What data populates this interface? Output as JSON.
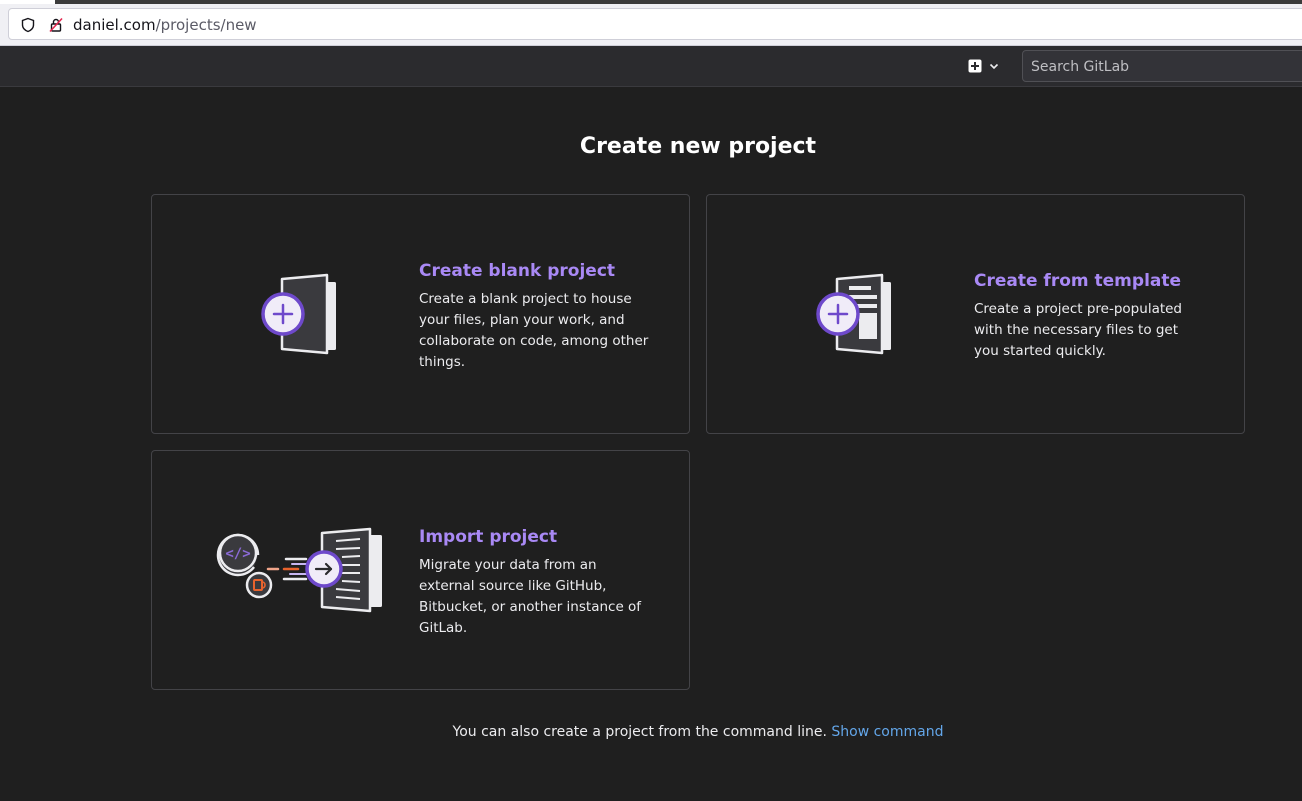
{
  "browser": {
    "url_host": "daniel.com",
    "url_path": "/projects/new"
  },
  "header": {
    "search_placeholder": "Search GitLab"
  },
  "main": {
    "title": "Create new project",
    "cards": [
      {
        "title": "Create blank project",
        "description": "Create a blank project to house your files, plan your work, and collaborate on code, among other things."
      },
      {
        "title": "Create from template",
        "description": "Create a project pre-populated with the necessary files to get you started quickly."
      },
      {
        "title": "Import project",
        "description": "Migrate your data from an external source like GitHub, Bitbucket, or another instance of GitLab."
      }
    ],
    "cli_text": "You can also create a project from the command line.",
    "cli_link": "Show command"
  },
  "colors": {
    "accent_purple": "#a989f5",
    "link_blue": "#63a6e9",
    "background": "#1f1f1f"
  }
}
